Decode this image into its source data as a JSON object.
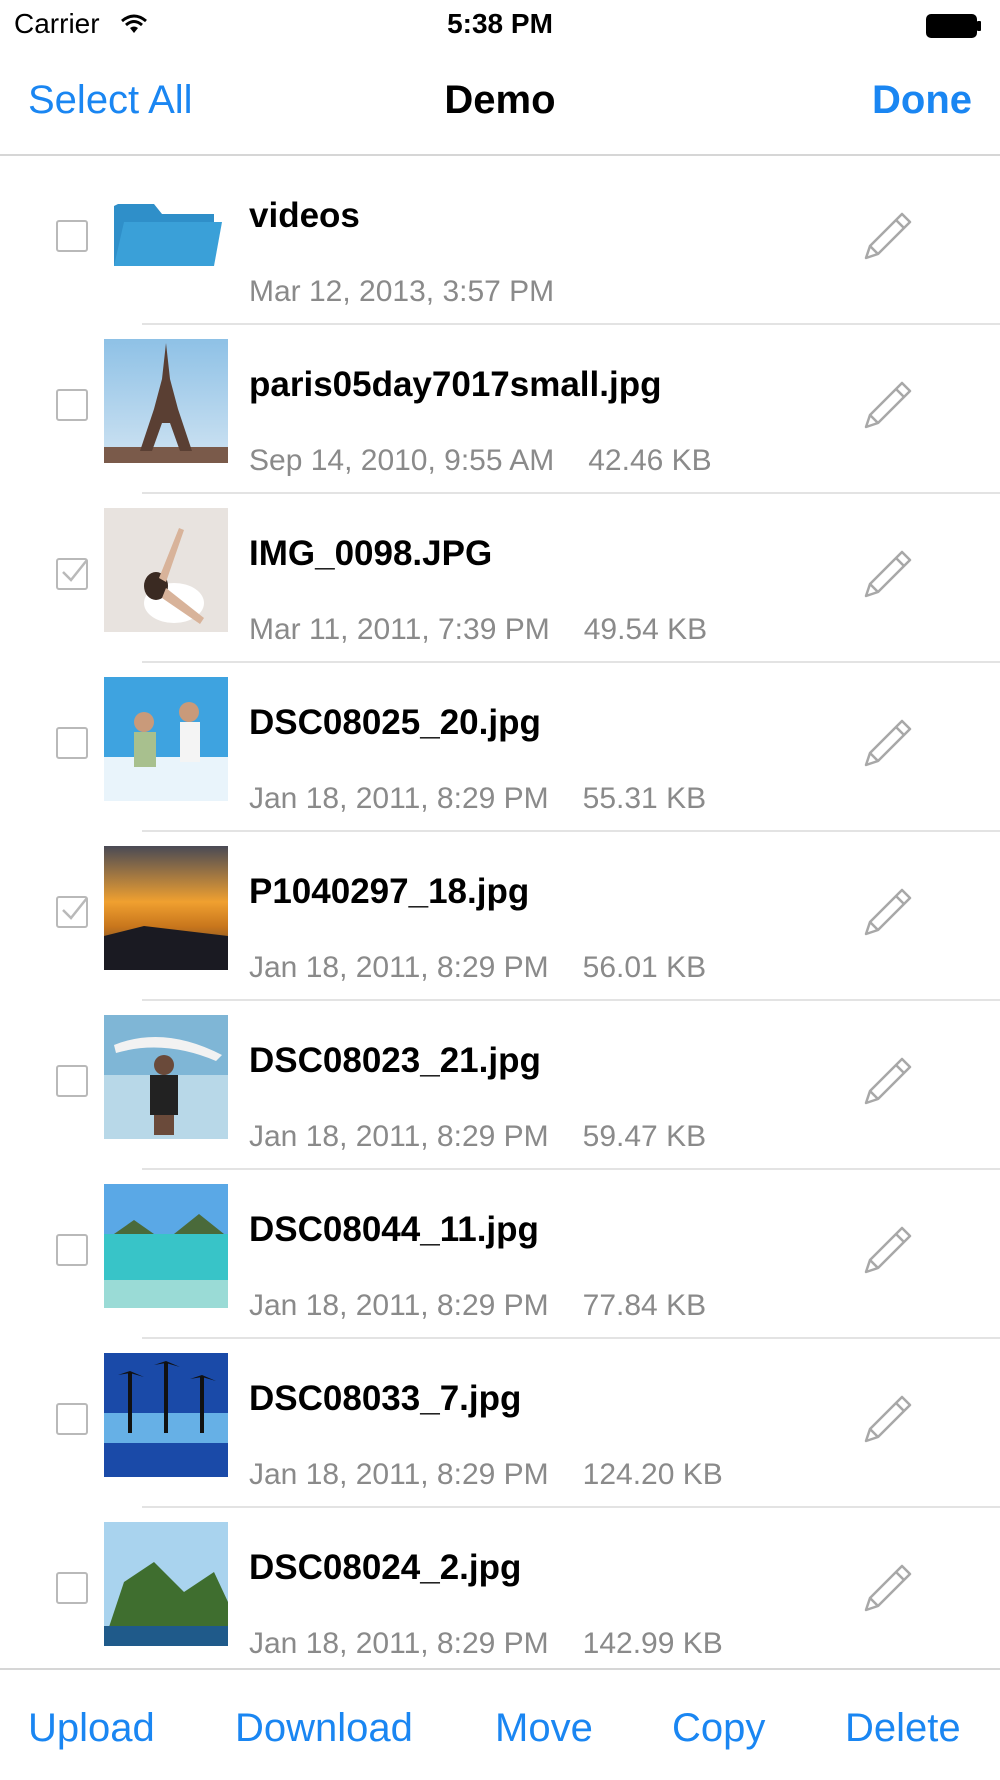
{
  "status_bar": {
    "carrier": "Carrier",
    "time": "5:38 PM"
  },
  "nav": {
    "left_button": "Select All",
    "title": "Demo",
    "right_button": "Done"
  },
  "files": [
    {
      "name": "videos",
      "date": "Mar 12, 2013, 3:57 PM",
      "size": "",
      "checked": false,
      "thumb": "folder-icon"
    },
    {
      "name": "paris05day7017small.jpg",
      "date": "Sep 14, 2010, 9:55 AM",
      "size": "42.46 KB",
      "checked": false,
      "thumb": "eiffel-tower-photo"
    },
    {
      "name": "IMG_0098.JPG",
      "date": "Mar 11, 2011, 7:39 PM",
      "size": "49.54 KB",
      "checked": true,
      "thumb": "dancer-photo"
    },
    {
      "name": "DSC08025_20.jpg",
      "date": "Jan 18, 2011, 8:29 PM",
      "size": "55.31 KB",
      "checked": false,
      "thumb": "beach-jump-photo"
    },
    {
      "name": "P1040297_18.jpg",
      "date": "Jan 18, 2011, 8:29 PM",
      "size": "56.01 KB",
      "checked": true,
      "thumb": "sunset-photo"
    },
    {
      "name": "DSC08023_21.jpg",
      "date": "Jan 18, 2011, 8:29 PM",
      "size": "59.47 KB",
      "checked": false,
      "thumb": "surfer-photo"
    },
    {
      "name": "DSC08044_11.jpg",
      "date": "Jan 18, 2011, 8:29 PM",
      "size": "77.84 KB",
      "checked": false,
      "thumb": "lagoon-photo"
    },
    {
      "name": "DSC08033_7.jpg",
      "date": "Jan 18, 2011, 8:29 PM",
      "size": "124.20 KB",
      "checked": false,
      "thumb": "palm-trees-photo"
    },
    {
      "name": "DSC08024_2.jpg",
      "date": "Jan 18, 2011, 8:29 PM",
      "size": "142.99 KB",
      "checked": false,
      "thumb": "cliffs-photo"
    }
  ],
  "toolbar": {
    "upload": "Upload",
    "download": "Download",
    "move": "Move",
    "copy": "Copy",
    "delete": "Delete"
  },
  "colors": {
    "accent": "#1a86f2",
    "folder": "#2f8fc9",
    "secondary_text": "#8a8a8a",
    "separator": "#e3e3e3"
  }
}
